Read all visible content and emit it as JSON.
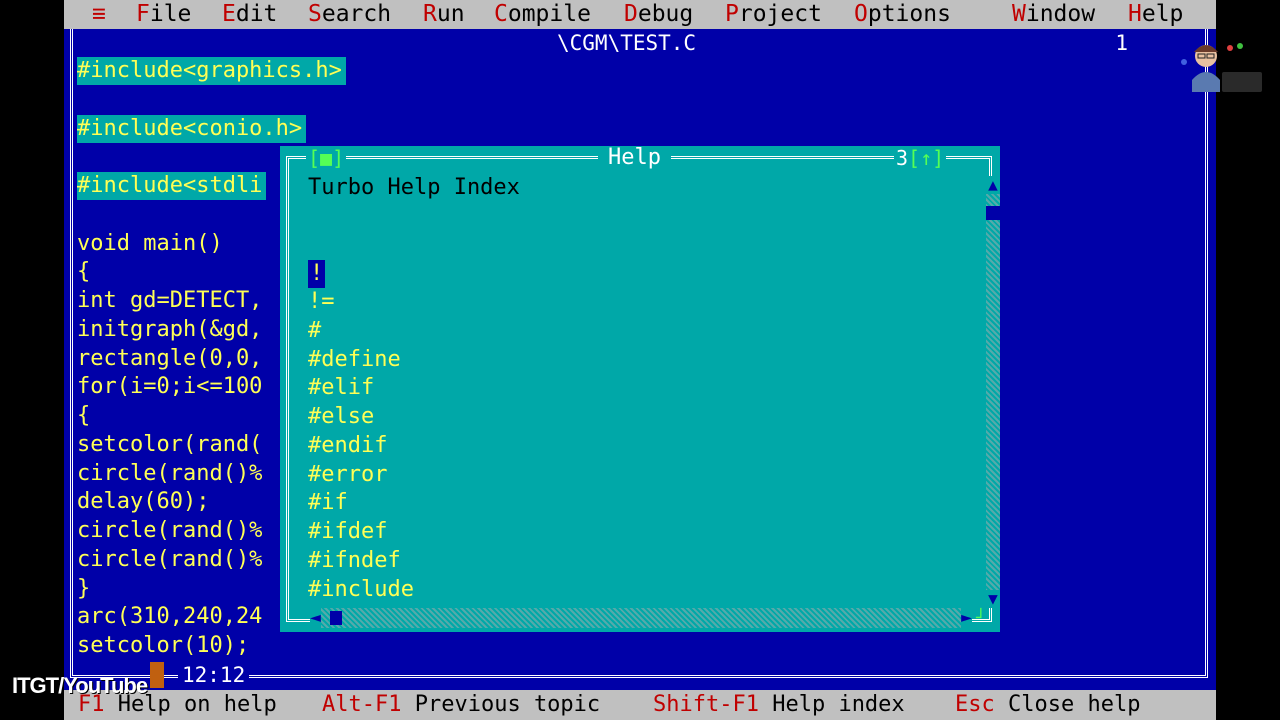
{
  "menubar": {
    "system_icon": "≡",
    "items": [
      {
        "hot": "F",
        "rest": "ile"
      },
      {
        "hot": "E",
        "rest": "dit"
      },
      {
        "hot": "S",
        "rest": "earch"
      },
      {
        "hot": "R",
        "rest": "un"
      },
      {
        "hot": "C",
        "rest": "ompile"
      },
      {
        "hot": "D",
        "rest": "ebug"
      },
      {
        "hot": "P",
        "rest": "roject"
      },
      {
        "hot": "O",
        "rest": "ptions"
      },
      {
        "hot": "W",
        "rest": "indow"
      },
      {
        "hot": "H",
        "rest": "elp"
      }
    ]
  },
  "editor": {
    "title": "\\CGM\\TEST.C",
    "window_number": "1",
    "cursor_position": "12:12",
    "lines": [
      "#include<graphics.h>",
      "#include<conio.h>",
      "#include<stdli",
      "void main()",
      "{",
      "int gd=DETECT,",
      "initgraph(&gd,",
      "rectangle(0,0,",
      "for(i=0;i<=100",
      "{",
      "setcolor(rand(",
      "circle(rand()%",
      "delay(60);",
      "circle(rand()%",
      "circle(rand()%",
      "}",
      "arc(310,240,24",
      "setcolor(10);"
    ]
  },
  "help": {
    "title": "Help",
    "close_glyph": "[■]",
    "window_number": "3",
    "zoom_glyph": "[↑]",
    "heading": "Turbo Help Index",
    "topics": [
      "!",
      "!=",
      "#",
      "#define",
      "#elif",
      "#else",
      "#endif",
      "#error",
      "#if",
      "#ifdef",
      "#ifndef",
      "#include"
    ],
    "selected_index": 0
  },
  "statusbar": {
    "items": [
      {
        "key": "F1",
        "label": "Help on help"
      },
      {
        "key": "Alt-F1",
        "label": "Previous topic"
      },
      {
        "key": "Shift-F1",
        "label": "Help index"
      },
      {
        "key": "Esc",
        "label": "Close help"
      }
    ]
  },
  "watermark": "ITGT/YouTube",
  "colors": {
    "desktop_blue": "#0000a8",
    "help_cyan": "#00a8a8",
    "code_yellow": "#ffff55",
    "menu_gray": "#c0c0c0",
    "hotkey_red": "#c00000"
  }
}
